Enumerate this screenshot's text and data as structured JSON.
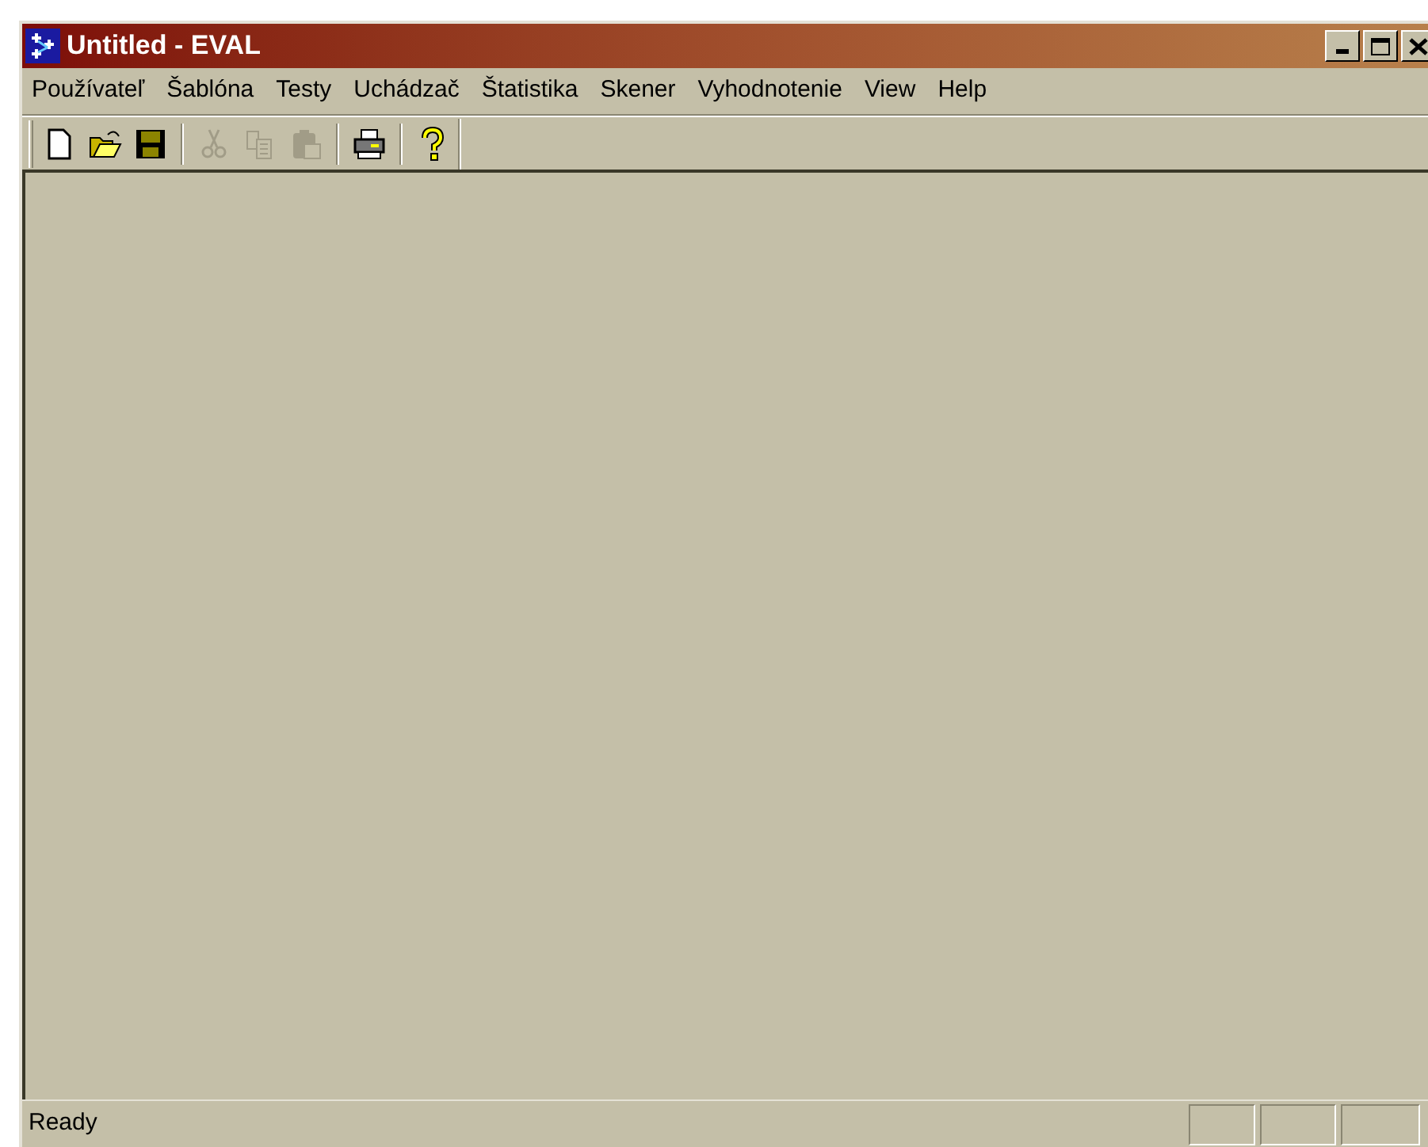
{
  "window": {
    "title": "Untitled - EVAL"
  },
  "menu": [
    "Používateľ",
    "Šablóna",
    "Testy",
    "Uchádzač",
    "Štatistika",
    "Skener",
    "Vyhodnotenie",
    "View",
    "Help"
  ],
  "toolbar": [
    {
      "kind": "new",
      "disabled": false
    },
    {
      "kind": "open",
      "disabled": false
    },
    {
      "kind": "save",
      "disabled": false
    },
    {
      "kind": "separator"
    },
    {
      "kind": "cut",
      "disabled": true
    },
    {
      "kind": "copy",
      "disabled": true
    },
    {
      "kind": "paste",
      "disabled": true
    },
    {
      "kind": "separator"
    },
    {
      "kind": "print",
      "disabled": false
    },
    {
      "kind": "separator"
    },
    {
      "kind": "help",
      "disabled": false
    }
  ],
  "status_bar": {
    "text": "Ready"
  }
}
